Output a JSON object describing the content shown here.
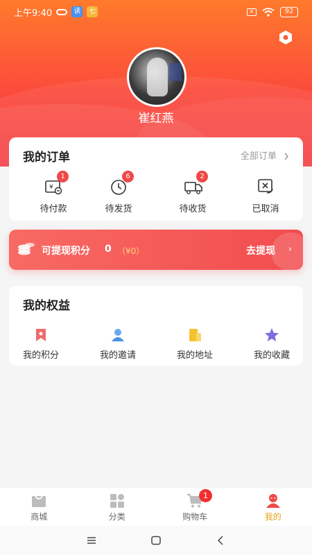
{
  "status_bar": {
    "time": "上午9:40",
    "app1": "读",
    "app2": "七",
    "battery": "92"
  },
  "user": {
    "name": "崔红燕"
  },
  "orders": {
    "title": "我的订单",
    "all_link": "全部订单",
    "items": [
      {
        "label": "待付款",
        "badge": "1",
        "icon": "wallet-icon"
      },
      {
        "label": "待发货",
        "badge": "6",
        "icon": "clock-icon"
      },
      {
        "label": "待收货",
        "badge": "2",
        "icon": "truck-icon"
      },
      {
        "label": "已取消",
        "badge": "",
        "icon": "cancel-icon"
      }
    ]
  },
  "points": {
    "label": "可提现积分",
    "value": "0",
    "yen": "（¥0）",
    "action": "去提现",
    "chevron": "›"
  },
  "rights": {
    "title": "我的权益",
    "items": [
      {
        "label": "我的积分",
        "icon": "bookmark-icon",
        "color": "#f06a6a"
      },
      {
        "label": "我的邀请",
        "icon": "invite-icon",
        "color": "#4a90e2"
      },
      {
        "label": "我的地址",
        "icon": "address-icon",
        "color": "#f5c12e"
      },
      {
        "label": "我的收藏",
        "icon": "star-icon",
        "color": "#7a6fe0"
      }
    ]
  },
  "tabbar": {
    "items": [
      {
        "label": "商城",
        "icon": "shop-icon"
      },
      {
        "label": "分类",
        "icon": "category-icon"
      },
      {
        "label": "购物车",
        "icon": "cart-icon",
        "badge": "1"
      },
      {
        "label": "我的",
        "icon": "profile-icon",
        "active": true
      }
    ]
  },
  "colors": {
    "accent": "#f24c4f",
    "active_tab": "#e8a020",
    "badge": "#f04848"
  }
}
